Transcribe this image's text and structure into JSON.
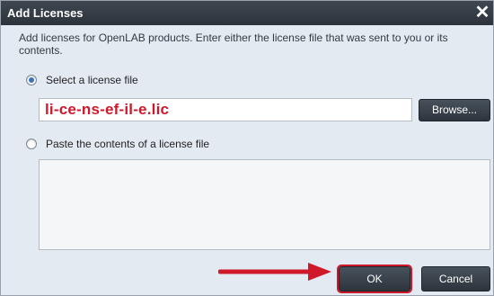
{
  "dialog": {
    "title": "Add Licenses",
    "close_label": "✕",
    "description": "Add licenses for OpenLAB products. Enter either the license file that was sent to you or its contents.",
    "option_file_label": "Select a license file",
    "option_paste_label": "Paste the contents of a license file",
    "file_value": "li-ce-ns-ef-il-e.lic",
    "browse_label": "Browse...",
    "ok_label": "OK",
    "cancel_label": "Cancel",
    "selected_option": "Select a license file",
    "highlight_color": "#d0182b"
  }
}
